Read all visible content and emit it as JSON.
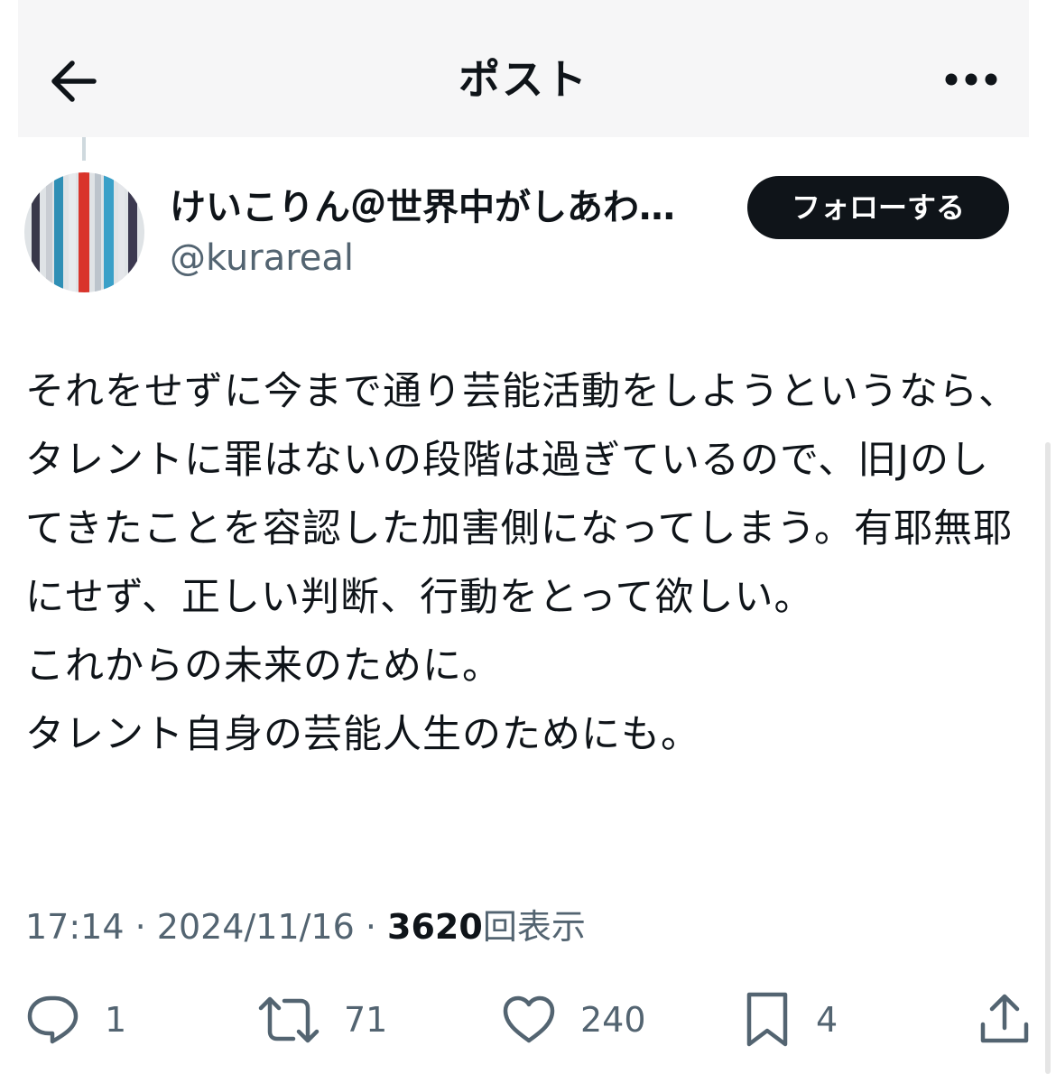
{
  "header": {
    "title": "ポスト",
    "back_icon": "arrow-left-icon",
    "more_icon": "more-horizontal-icon"
  },
  "user": {
    "display_name": "けいこりん＠世界中がしあわ…",
    "handle": "@kurareal",
    "follow_label": "フォローする"
  },
  "post": {
    "lines": [
      "それをせずに今まで通り芸能活動をしようというなら、タレントに罪はないの段階は過ぎているので、旧Jのしてきたことを容認した加害側になってしまう。有耶無耶にせず、正しい判断、行動をとって欲しい。",
      "これからの未来のために。",
      "タレント自身の芸能人生のためにも。"
    ]
  },
  "meta": {
    "time": "17:14",
    "separator": " · ",
    "date": "2024/11/16",
    "views": "3620",
    "views_label": "回表示"
  },
  "actions": {
    "reply": {
      "icon": "reply-icon",
      "count": "1"
    },
    "repost": {
      "icon": "repost-icon",
      "count": "71"
    },
    "like": {
      "icon": "heart-icon",
      "count": "240"
    },
    "bookmark": {
      "icon": "bookmark-icon",
      "count": "4"
    },
    "share": {
      "icon": "share-icon"
    }
  },
  "colors": {
    "text": "#0f1419",
    "secondary": "#536471",
    "header_bg": "#f6f6f7",
    "follow_bg": "#0f1419"
  }
}
